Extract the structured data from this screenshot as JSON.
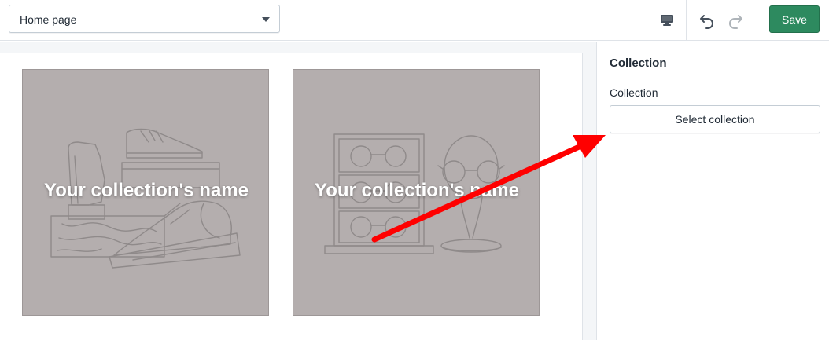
{
  "topbar": {
    "page_select_value": "Home page",
    "save_label": "Save",
    "icons": [
      "desktop-icon",
      "undo-icon",
      "redo-icon",
      "chevron-down-icon"
    ]
  },
  "preview": {
    "tiles": [
      {
        "title": "Your collection's name",
        "illustration": "shoes-illustration"
      },
      {
        "title": "Your collection's name",
        "illustration": "glasses-illustration"
      }
    ]
  },
  "sidebar": {
    "heading": "Collection",
    "field_label": "Collection",
    "select_button": "Select collection"
  },
  "annotation": {
    "arrow_color": "#ff0000"
  },
  "colors": {
    "accent": "#2d8a5f",
    "tile_bg": "#b4aeae",
    "border": "#dfe3e8"
  }
}
